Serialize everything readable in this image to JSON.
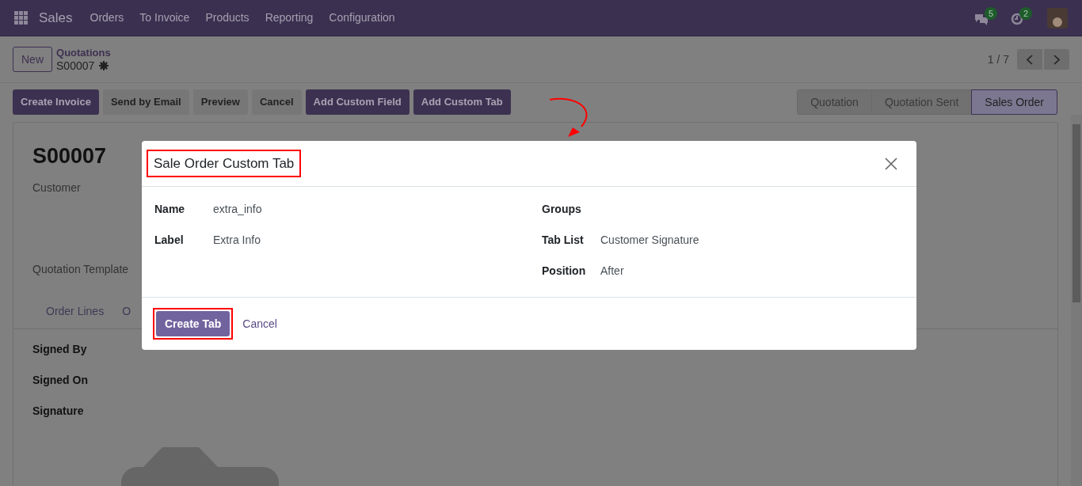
{
  "navbar": {
    "app": "Sales",
    "menu": [
      "Orders",
      "To Invoice",
      "Products",
      "Reporting",
      "Configuration"
    ],
    "messages_badge": "5",
    "activities_badge": "2"
  },
  "control_panel": {
    "new_button": "New",
    "breadcrumb": "Quotations",
    "record": "S00007",
    "pager": "1 / 7"
  },
  "actions": [
    {
      "label": "Create Invoice",
      "kind": "primary"
    },
    {
      "label": "Send by Email",
      "kind": "secondary"
    },
    {
      "label": "Preview",
      "kind": "secondary"
    },
    {
      "label": "Cancel",
      "kind": "secondary"
    },
    {
      "label": "Add Custom Field",
      "kind": "primary"
    },
    {
      "label": "Add Custom Tab",
      "kind": "primary"
    }
  ],
  "statusbar": [
    {
      "label": "Quotation",
      "selected": false
    },
    {
      "label": "Quotation Sent",
      "selected": false
    },
    {
      "label": "Sales Order",
      "selected": true
    }
  ],
  "form": {
    "title": "S00007",
    "fields": [
      "Customer",
      "Quotation Template"
    ],
    "tabs": [
      "Order Lines",
      "O"
    ],
    "signature_fields": [
      "Signed By",
      "Signed On",
      "Signature"
    ]
  },
  "dialog": {
    "title": "Sale Order Custom Tab",
    "left_fields": [
      {
        "label": "Name",
        "value": "extra_info"
      },
      {
        "label": "Label",
        "value": "Extra Info"
      }
    ],
    "right_fields": [
      {
        "label": "Groups"
      },
      {
        "label": "Tab List",
        "value": "Customer Signature"
      },
      {
        "label": "Position",
        "value": "After"
      }
    ],
    "primary_button": "Create Tab",
    "secondary_button": "Cancel"
  }
}
